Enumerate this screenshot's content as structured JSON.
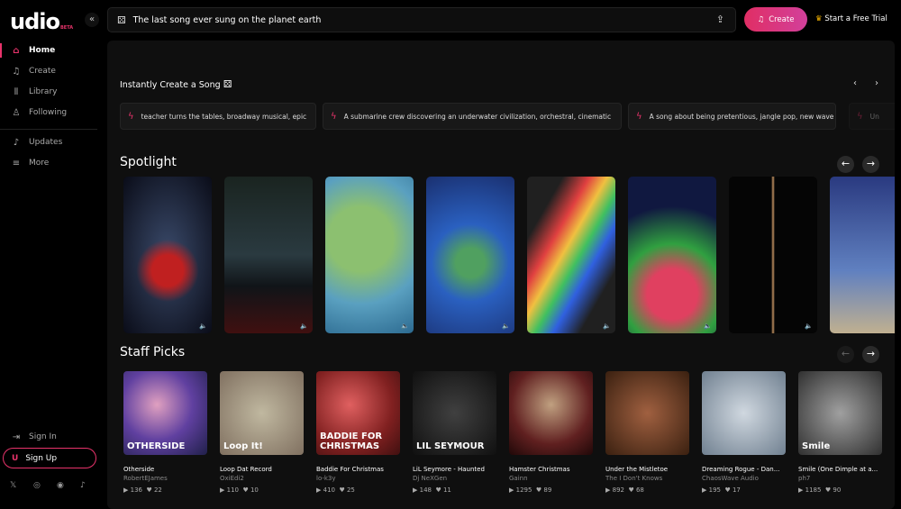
{
  "app": {
    "logo": "udio",
    "beta": "BETA",
    "collapse": "«"
  },
  "sidebar": {
    "items": [
      {
        "label": "Home",
        "icon": "home-icon",
        "g": "⌂"
      },
      {
        "label": "Create",
        "icon": "music-plus-icon",
        "g": "♫"
      },
      {
        "label": "Library",
        "icon": "library-icon",
        "g": "⫴"
      },
      {
        "label": "Following",
        "icon": "user-icon",
        "g": "♙"
      },
      {
        "label": "Updates",
        "icon": "bell-icon",
        "g": "♪"
      },
      {
        "label": "More",
        "icon": "menu-icon",
        "g": "≡"
      }
    ],
    "sign_in": "Sign In",
    "sign_up": "Sign Up",
    "social": [
      "𝕏",
      "◎",
      "◉",
      "♪"
    ]
  },
  "topbar": {
    "prompt": "The last song ever sung on the planet earth",
    "create": "Create",
    "trial": "Start a Free Trial"
  },
  "instant": {
    "title": "Instantly Create a Song",
    "prompts": [
      "teacher turns the tables, broadway musical, epic",
      "A submarine crew discovering an underwater civilization, orchestral, cinematic",
      "A song about being pretentious, jangle pop, new wave",
      "Un"
    ]
  },
  "spotlight": {
    "title": "Spotlight"
  },
  "staff_picks": {
    "title": "Staff Picks",
    "items": [
      {
        "title": "Otherside",
        "artist": "RobertEJames",
        "plays": "136",
        "likes": "22",
        "overlay": "OTHERSIDE"
      },
      {
        "title": "Loop Dat Record",
        "artist": "OxiEdi2",
        "plays": "110",
        "likes": "10",
        "overlay": "Loop It!"
      },
      {
        "title": "Baddie For Christmas",
        "artist": "lo-k3y",
        "plays": "410",
        "likes": "25",
        "overlay": "BADDIE FOR CHRISTMAS"
      },
      {
        "title": "LiL Seymore - Haunted",
        "artist": "Dj NeXGen",
        "plays": "148",
        "likes": "11",
        "overlay": "LIL SEYMOUR"
      },
      {
        "title": "Hamster Christmas",
        "artist": "Gainn",
        "plays": "1295",
        "likes": "89",
        "overlay": ""
      },
      {
        "title": "Under the Mistletoe",
        "artist": "The I Don't Knows",
        "plays": "892",
        "likes": "68",
        "overlay": ""
      },
      {
        "title": "Dreaming Rogue - Dan...",
        "artist": "ChaosWave Audio",
        "plays": "195",
        "likes": "17",
        "overlay": ""
      },
      {
        "title": "Smile (One Dimple at a...",
        "artist": "ph7",
        "plays": "1185",
        "likes": "90",
        "overlay": "Smile"
      }
    ]
  },
  "colors": {
    "accent": "#e8336b",
    "bg": "#000000",
    "panel": "#0f0f0f"
  }
}
